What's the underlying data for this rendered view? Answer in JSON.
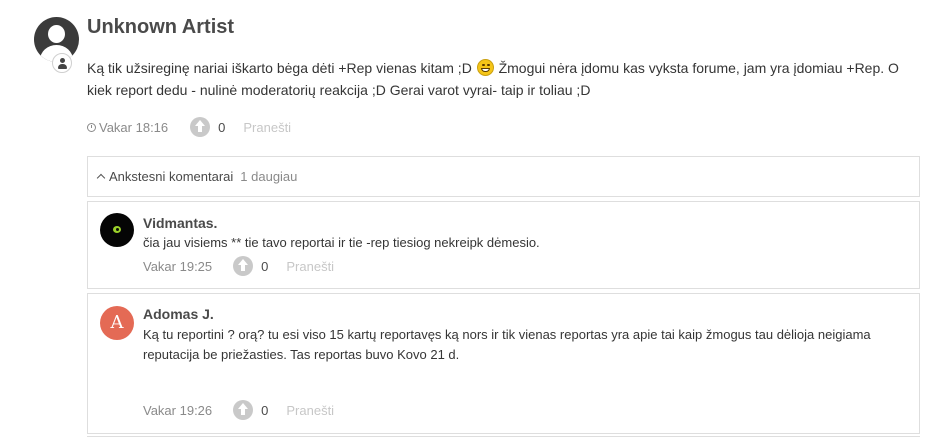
{
  "post": {
    "author": "Unknown Artist",
    "body_part1": "Ką tik užsireginę nariai iškarto bėga dėti +Rep vienas kitam ;D",
    "body_part2": "Žmogui nėra įdomu kas vyksta forume, jam yra įdomiau +Rep. O kiek report dedu - nulinė moderatorių reakcija ;D Gerai varot vyrai- taip ir toliau ;D",
    "time": "Vakar 18:16",
    "votes": "0",
    "report_label": "Pranešti",
    "avatar_icon": "default-user-avatar",
    "badge_icon": "user-role-icon"
  },
  "comments_header": {
    "label": "Ankstesni komentarai",
    "more": "1 daugiau"
  },
  "comments": [
    {
      "author": "Vidmantas.",
      "body": "čia jau visiems ** tie tavo reportai ir tie -rep tiesiog nekreipk dėmesio.",
      "time": "Vakar 19:25",
      "votes": "0",
      "report_label": "Pranešti"
    },
    {
      "author": "Adomas J.",
      "avatar_letter": "A",
      "avatar_color": "#e46a55",
      "body": "Ką tu reportini ? orą? tu esi viso 15 kartų reportavęs ką nors ir tik vienas reportas yra apie tai kaip žmogus tau dėlioja neigiama reputacija be priežasties. Tas reportas buvo Kovo 21 d.",
      "time": "Vakar 19:26",
      "votes": "0",
      "report_label": "Pranešti"
    }
  ]
}
